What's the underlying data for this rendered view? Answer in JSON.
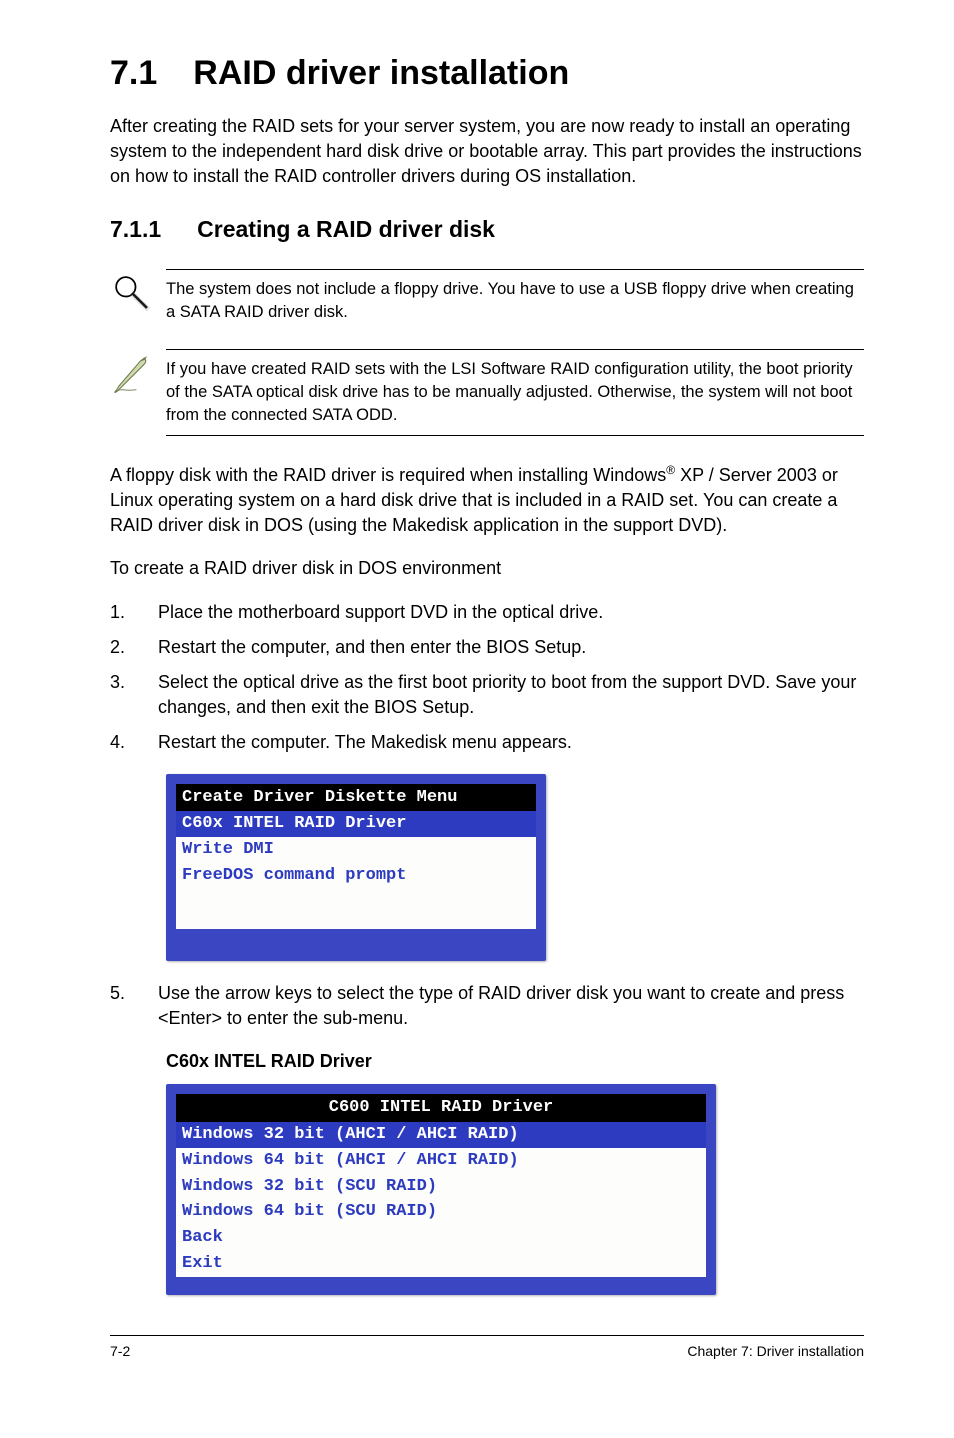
{
  "section": {
    "number": "7.1",
    "title": "RAID driver installation",
    "intro": "After creating the RAID sets for your server system, you are now ready to install an operating system to the independent hard disk drive or bootable array. This part provides the instructions on how to install the RAID controller drivers during OS installation."
  },
  "subsection": {
    "number": "7.1.1",
    "title": "Creating a RAID driver disk"
  },
  "notes": [
    "The system does not include a floppy drive. You have to use a USB floppy drive when creating a SATA RAID driver disk.",
    "If you have created RAID sets with the LSI Software RAID configuration utility, the boot priority of the SATA optical disk drive has to be manually adjusted. Otherwise, the system will not boot from the connected SATA ODD."
  ],
  "body": {
    "para1_pre": "A floppy disk with the RAID driver is required when installing Windows",
    "para1_sup": "®",
    "para1_post": " XP / Server 2003 or Linux operating system on a hard disk drive that is included in a RAID set. You can create a RAID driver disk in DOS (using the Makedisk application in the support DVD).",
    "para2": "To create a RAID driver disk in DOS environment"
  },
  "steps": [
    {
      "n": "1.",
      "t": "Place the motherboard support DVD in the optical drive."
    },
    {
      "n": "2.",
      "t": "Restart the computer, and then enter the BIOS Setup."
    },
    {
      "n": "3.",
      "t": "Select the optical drive as the first boot priority to boot from the support DVD. Save your changes, and then exit the BIOS Setup."
    },
    {
      "n": "4.",
      "t": "Restart the computer. The Makedisk menu appears."
    }
  ],
  "screen1": {
    "title": "Create Driver Diskette Menu",
    "rows": [
      {
        "label": "C60x INTEL RAID Driver",
        "selected": true
      },
      {
        "label": "Write DMI",
        "selected": false
      },
      {
        "label": "FreeDOS command prompt",
        "selected": false
      }
    ]
  },
  "step5": {
    "n": "5.",
    "t": "Use the arrow keys to select the type of RAID driver disk you want to create and press <Enter> to enter the sub-menu."
  },
  "sublabel": "C60x INTEL RAID Driver",
  "screen2": {
    "title": "C600 INTEL RAID Driver",
    "rows": [
      {
        "label": "Windows 32 bit (AHCI / AHCI RAID)",
        "selected": true
      },
      {
        "label": "Windows 64 bit (AHCI / AHCI RAID)",
        "selected": false
      },
      {
        "label": "Windows 32 bit (SCU RAID)",
        "selected": false
      },
      {
        "label": "Windows 64 bit (SCU RAID)",
        "selected": false
      },
      {
        "label": "Back",
        "selected": false
      },
      {
        "label": "Exit",
        "selected": false
      }
    ]
  },
  "footer": {
    "left": "7-2",
    "right": "Chapter 7: Driver installation"
  }
}
